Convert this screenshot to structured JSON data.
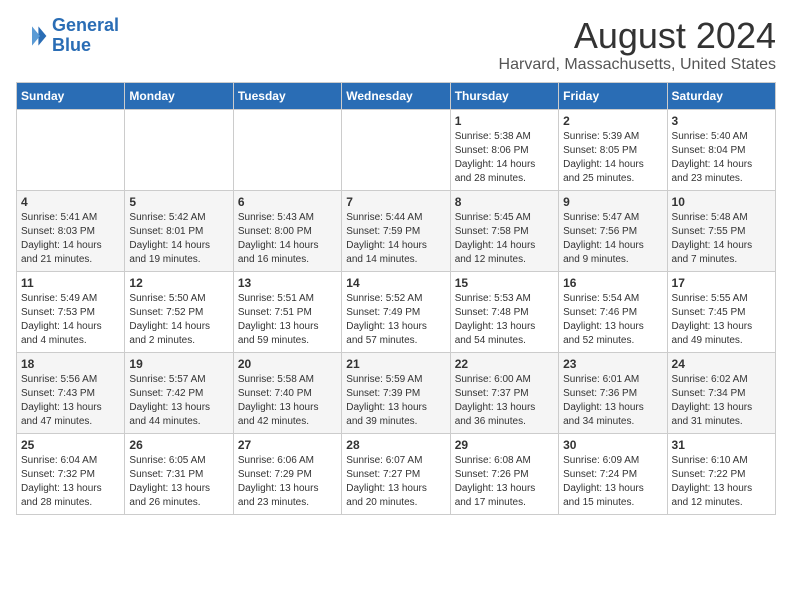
{
  "logo": {
    "line1": "General",
    "line2": "Blue"
  },
  "title": "August 2024",
  "subtitle": "Harvard, Massachusetts, United States",
  "headers": [
    "Sunday",
    "Monday",
    "Tuesday",
    "Wednesday",
    "Thursday",
    "Friday",
    "Saturday"
  ],
  "weeks": [
    [
      {
        "day": "",
        "detail": ""
      },
      {
        "day": "",
        "detail": ""
      },
      {
        "day": "",
        "detail": ""
      },
      {
        "day": "",
        "detail": ""
      },
      {
        "day": "1",
        "detail": "Sunrise: 5:38 AM\nSunset: 8:06 PM\nDaylight: 14 hours\nand 28 minutes."
      },
      {
        "day": "2",
        "detail": "Sunrise: 5:39 AM\nSunset: 8:05 PM\nDaylight: 14 hours\nand 25 minutes."
      },
      {
        "day": "3",
        "detail": "Sunrise: 5:40 AM\nSunset: 8:04 PM\nDaylight: 14 hours\nand 23 minutes."
      }
    ],
    [
      {
        "day": "4",
        "detail": "Sunrise: 5:41 AM\nSunset: 8:03 PM\nDaylight: 14 hours\nand 21 minutes."
      },
      {
        "day": "5",
        "detail": "Sunrise: 5:42 AM\nSunset: 8:01 PM\nDaylight: 14 hours\nand 19 minutes."
      },
      {
        "day": "6",
        "detail": "Sunrise: 5:43 AM\nSunset: 8:00 PM\nDaylight: 14 hours\nand 16 minutes."
      },
      {
        "day": "7",
        "detail": "Sunrise: 5:44 AM\nSunset: 7:59 PM\nDaylight: 14 hours\nand 14 minutes."
      },
      {
        "day": "8",
        "detail": "Sunrise: 5:45 AM\nSunset: 7:58 PM\nDaylight: 14 hours\nand 12 minutes."
      },
      {
        "day": "9",
        "detail": "Sunrise: 5:47 AM\nSunset: 7:56 PM\nDaylight: 14 hours\nand 9 minutes."
      },
      {
        "day": "10",
        "detail": "Sunrise: 5:48 AM\nSunset: 7:55 PM\nDaylight: 14 hours\nand 7 minutes."
      }
    ],
    [
      {
        "day": "11",
        "detail": "Sunrise: 5:49 AM\nSunset: 7:53 PM\nDaylight: 14 hours\nand 4 minutes."
      },
      {
        "day": "12",
        "detail": "Sunrise: 5:50 AM\nSunset: 7:52 PM\nDaylight: 14 hours\nand 2 minutes."
      },
      {
        "day": "13",
        "detail": "Sunrise: 5:51 AM\nSunset: 7:51 PM\nDaylight: 13 hours\nand 59 minutes."
      },
      {
        "day": "14",
        "detail": "Sunrise: 5:52 AM\nSunset: 7:49 PM\nDaylight: 13 hours\nand 57 minutes."
      },
      {
        "day": "15",
        "detail": "Sunrise: 5:53 AM\nSunset: 7:48 PM\nDaylight: 13 hours\nand 54 minutes."
      },
      {
        "day": "16",
        "detail": "Sunrise: 5:54 AM\nSunset: 7:46 PM\nDaylight: 13 hours\nand 52 minutes."
      },
      {
        "day": "17",
        "detail": "Sunrise: 5:55 AM\nSunset: 7:45 PM\nDaylight: 13 hours\nand 49 minutes."
      }
    ],
    [
      {
        "day": "18",
        "detail": "Sunrise: 5:56 AM\nSunset: 7:43 PM\nDaylight: 13 hours\nand 47 minutes."
      },
      {
        "day": "19",
        "detail": "Sunrise: 5:57 AM\nSunset: 7:42 PM\nDaylight: 13 hours\nand 44 minutes."
      },
      {
        "day": "20",
        "detail": "Sunrise: 5:58 AM\nSunset: 7:40 PM\nDaylight: 13 hours\nand 42 minutes."
      },
      {
        "day": "21",
        "detail": "Sunrise: 5:59 AM\nSunset: 7:39 PM\nDaylight: 13 hours\nand 39 minutes."
      },
      {
        "day": "22",
        "detail": "Sunrise: 6:00 AM\nSunset: 7:37 PM\nDaylight: 13 hours\nand 36 minutes."
      },
      {
        "day": "23",
        "detail": "Sunrise: 6:01 AM\nSunset: 7:36 PM\nDaylight: 13 hours\nand 34 minutes."
      },
      {
        "day": "24",
        "detail": "Sunrise: 6:02 AM\nSunset: 7:34 PM\nDaylight: 13 hours\nand 31 minutes."
      }
    ],
    [
      {
        "day": "25",
        "detail": "Sunrise: 6:04 AM\nSunset: 7:32 PM\nDaylight: 13 hours\nand 28 minutes."
      },
      {
        "day": "26",
        "detail": "Sunrise: 6:05 AM\nSunset: 7:31 PM\nDaylight: 13 hours\nand 26 minutes."
      },
      {
        "day": "27",
        "detail": "Sunrise: 6:06 AM\nSunset: 7:29 PM\nDaylight: 13 hours\nand 23 minutes."
      },
      {
        "day": "28",
        "detail": "Sunrise: 6:07 AM\nSunset: 7:27 PM\nDaylight: 13 hours\nand 20 minutes."
      },
      {
        "day": "29",
        "detail": "Sunrise: 6:08 AM\nSunset: 7:26 PM\nDaylight: 13 hours\nand 17 minutes."
      },
      {
        "day": "30",
        "detail": "Sunrise: 6:09 AM\nSunset: 7:24 PM\nDaylight: 13 hours\nand 15 minutes."
      },
      {
        "day": "31",
        "detail": "Sunrise: 6:10 AM\nSunset: 7:22 PM\nDaylight: 13 hours\nand 12 minutes."
      }
    ]
  ]
}
